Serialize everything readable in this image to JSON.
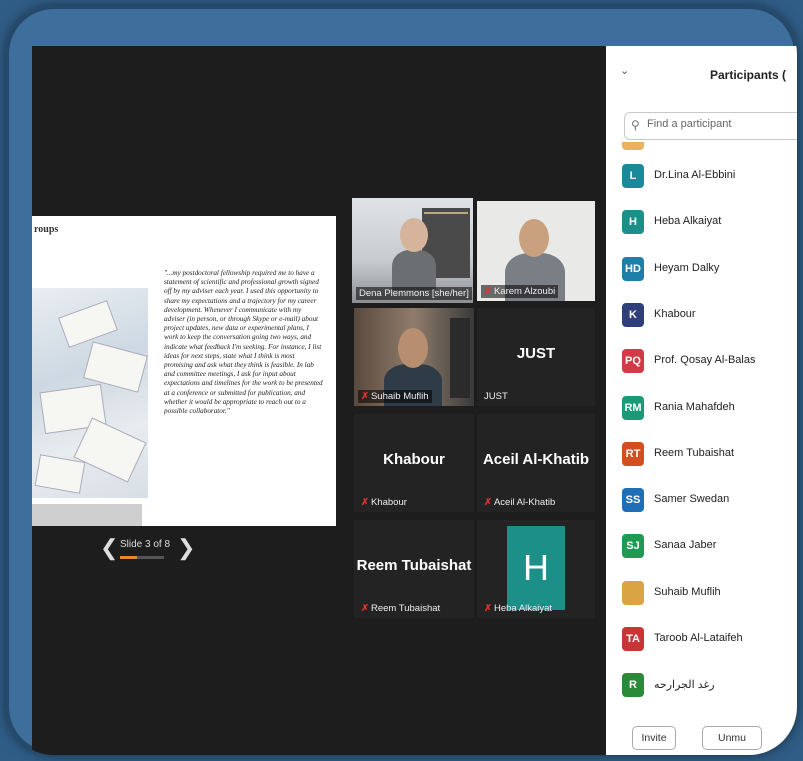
{
  "slide": {
    "title": "roups",
    "sub1": "",
    "sub2": "",
    "quote": "\"...my postdoctoral fellowship required me to have a statement of scientific and professional growth signed off by my adviser each year. I used this opportunity to share my expectations and a trajectory for my career development. Whenever I communicate with my adviser (in person, or through Skype or e-mail) about project updates, new data or experimental plans, I work to keep the conversation going two ways, and indicate what feedback I'm seeking. For instance, I list ideas for next steps, state what I think is most promising and ask what they think is feasible. In lab and committee meetings, I ask for input about expectations and timelines for the work to be presented at a conference or submitted for publication, and whether it would be appropriate to reach out to a possible collaborator.\"",
    "counter": "Slide 3 of 8",
    "progress": 0.375,
    "prev_icon": "chevron-left-icon",
    "next_icon": "chevron-right-icon"
  },
  "tiles": [
    {
      "label": "Dena Plemmons [she/her]",
      "muted": false,
      "active": true,
      "kind": "video"
    },
    {
      "label": "Karem Alzoubi",
      "muted": true,
      "active": false,
      "kind": "video"
    },
    {
      "label": "Suhaib Muflih",
      "muted": true,
      "active": false,
      "kind": "video"
    },
    {
      "label": "JUST",
      "big": "JUST",
      "muted": false,
      "active": false,
      "kind": "name"
    },
    {
      "label": "Khabour",
      "big": "Khabour",
      "muted": true,
      "active": false,
      "kind": "name"
    },
    {
      "label": "Aceil Al-Khatib",
      "big": "Aceil Al-Khatib",
      "muted": true,
      "active": false,
      "kind": "name"
    },
    {
      "label": "Reem Tubaishat",
      "big": "Reem Tubaishat",
      "muted": true,
      "active": false,
      "kind": "name"
    },
    {
      "label": "Heba Alkaiyat",
      "big": "H",
      "muted": true,
      "active": false,
      "kind": "avatar"
    }
  ],
  "panel": {
    "title": "Participants (",
    "collapse_icon": "chevron-down-icon",
    "search_placeholder": "Find a participant",
    "participants": [
      {
        "initials": "L",
        "name": "Dr.Lina Al-Ebbini",
        "color": "#1a8a9a"
      },
      {
        "initials": "H",
        "name": "Heba Alkaiyat",
        "color": "#1b8f88"
      },
      {
        "initials": "HD",
        "name": "Heyam Dalky",
        "color": "#1e7fa8"
      },
      {
        "initials": "K",
        "name": "Khabour",
        "color": "#2e3f7a"
      },
      {
        "initials": "PQ",
        "name": "Prof. Qosay Al-Balas",
        "color": "#d23a45"
      },
      {
        "initials": "RM",
        "name": "Rania Mahafdeh",
        "color": "#1b9a78"
      },
      {
        "initials": "RT",
        "name": "Reem Tubaishat",
        "color": "#d2501f"
      },
      {
        "initials": "SS",
        "name": "Samer Swedan",
        "color": "#1e6fb8"
      },
      {
        "initials": "SJ",
        "name": "Sanaa Jaber",
        "color": "#1f9a52"
      },
      {
        "initials": "",
        "name": "Suhaib Muflih",
        "color": "#d9a441"
      },
      {
        "initials": "TA",
        "name": "Taroob Al-Lataifeh",
        "color": "#c93434"
      },
      {
        "initials": "R",
        "name": "رغد الجرارحه",
        "color": "#2a8a3a"
      }
    ],
    "invite_label": "Invite",
    "unmute_label": "Unmu"
  },
  "colors": {
    "active_speaker": "#c9d95a",
    "muted": "#e0332e",
    "progress": "#e58a2b"
  }
}
